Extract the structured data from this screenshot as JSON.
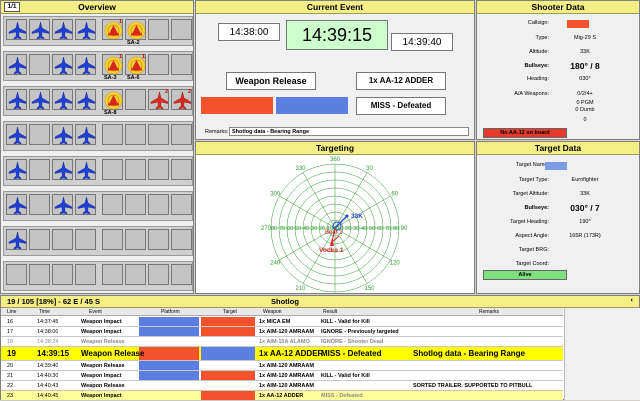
{
  "overview": {
    "title": "Overview",
    "page": "1/1",
    "rows": [
      {
        "cells": [
          "blue-jet",
          "blue-jet",
          "blue-jet",
          "blue-jet",
          "sam-site",
          "sam-site",
          "empty",
          "empty"
        ],
        "nums": [
          "",
          "",
          "",
          "",
          "1",
          "",
          "",
          ""
        ],
        "labels": [
          "",
          "",
          "",
          "",
          "",
          "SA-2",
          "",
          ""
        ]
      },
      {
        "cells": [
          "blue-jet",
          "empty",
          "blue-jet",
          "blue-jet",
          "sam-site",
          "sam-site",
          "empty",
          "empty"
        ],
        "nums": [
          "",
          "",
          "",
          "",
          "1",
          "1",
          "",
          ""
        ],
        "labels": [
          "",
          "",
          "",
          "",
          "SA-3",
          "SA-6",
          "",
          ""
        ]
      },
      {
        "cells": [
          "blue-jet",
          "blue-jet",
          "blue-jet",
          "blue-jet",
          "sam-site",
          "empty",
          "red-jet",
          "red-jet"
        ],
        "nums": [
          "",
          "",
          "",
          "",
          "",
          "",
          "2",
          "2"
        ],
        "labels": [
          "",
          "",
          "",
          "",
          "SA-8",
          "",
          "",
          ""
        ]
      },
      {
        "cells": [
          "blue-jet",
          "empty",
          "blue-jet",
          "blue-jet",
          "empty",
          "empty",
          "empty",
          "empty"
        ],
        "nums": [
          "",
          "",
          "",
          "",
          "",
          "",
          "",
          ""
        ],
        "labels": [
          "",
          "",
          "",
          "",
          "",
          "",
          "",
          ""
        ]
      },
      {
        "cells": [
          "blue-jet",
          "empty",
          "blue-jet",
          "blue-jet",
          "empty",
          "empty",
          "empty",
          "empty"
        ],
        "nums": [
          "",
          "",
          "",
          "",
          "",
          "",
          "",
          ""
        ],
        "labels": [
          "",
          "",
          "",
          "",
          "",
          "",
          "",
          ""
        ]
      },
      {
        "cells": [
          "blue-jet",
          "empty",
          "blue-jet",
          "blue-jet",
          "empty",
          "empty",
          "empty",
          "empty"
        ],
        "nums": [
          "",
          "",
          "",
          "",
          "",
          "",
          "",
          ""
        ],
        "labels": [
          "",
          "",
          "",
          "",
          "",
          "",
          "",
          ""
        ]
      },
      {
        "cells": [
          "blue-jet",
          "empty",
          "empty",
          "empty",
          "empty",
          "empty",
          "empty",
          "empty"
        ],
        "nums": [
          "",
          "",
          "",
          "",
          "",
          "",
          "",
          ""
        ],
        "labels": [
          "",
          "",
          "",
          "",
          "",
          "",
          "",
          ""
        ]
      },
      {
        "cells": [
          "empty",
          "empty",
          "empty",
          "empty",
          "empty",
          "empty",
          "empty",
          "empty"
        ],
        "nums": [
          "",
          "",
          "",
          "",
          "",
          "",
          "",
          ""
        ],
        "labels": [
          "",
          "",
          "",
          "",
          "",
          "",
          "",
          ""
        ]
      }
    ]
  },
  "current_event": {
    "title": "Current Event",
    "time_prev": "14:38:00",
    "time_now": "14:39:15",
    "time_next": "14:39:40",
    "event_type": "Weapon Release",
    "weapon": "1x AA-12 ADDER",
    "result": "MISS - Defeated",
    "shooter_color": "#f4522c",
    "target_color": "#5b7fe0",
    "remarks_label": "Remarks:",
    "remarks": "Shotlog data - Bearing Range"
  },
  "targeting": {
    "title": "Targeting",
    "ring_labels": [
      "10",
      "20",
      "30",
      "40",
      "50",
      "60",
      "70",
      "80"
    ],
    "bearing_labels": [
      "360",
      "30",
      "60",
      "90",
      "120",
      "150",
      "180",
      "210",
      "240",
      "270",
      "300",
      "330"
    ],
    "contacts": [
      {
        "label": "33K",
        "color": "#2244cc"
      },
      {
        "label": "Vodka 1",
        "color": "#cc2222"
      },
      {
        "label": "Bear 2",
        "color": "#cc2222"
      }
    ]
  },
  "shooter": {
    "title": "Shooter Data",
    "callsign_label": "Callsign:",
    "callsign_color": "#f4522c",
    "type_label": "Type:",
    "type": "Mig-29 S",
    "altitude_label": "Altitude:",
    "altitude": "33K",
    "bullseye_label": "Bullseye:",
    "bullseye": "180° / 8",
    "heading_label": "Heading:",
    "heading": "030°",
    "aa_label": "A/A Weapons:",
    "aa": "0/2/4+",
    "pgm": "0 PGM",
    "dumb": "0 Dumb",
    "zero": "0",
    "status": "No AA-12 on board",
    "status_color": "#e63a2a"
  },
  "target": {
    "title": "Target Data",
    "name_label": "Target Name:",
    "name_color": "#7a9be6",
    "type_label": "Target Type:",
    "type": "Eurofighter",
    "altitude_label": "Target Altitude:",
    "altitude": "33K",
    "bullseye_label": "Bullseye:",
    "bullseye": "030° / 7",
    "heading_label": "Target Heading:",
    "heading": "190°",
    "aspect_label": "Aspect Angle:",
    "aspect": "165R (173R)",
    "brg_label": "Target BRG:",
    "coord_label": "Target Coord:",
    "status": "Alive",
    "status_color": "#7fe07f"
  },
  "shotlog": {
    "title": "Shotlog",
    "summary": "19 / 105 [18%] - 62 E / 45 S",
    "columns": [
      "Line",
      "Time",
      "Event",
      "Platform",
      "Target",
      "Weapon",
      "Result",
      "Remarks"
    ],
    "rows": [
      {
        "line": "16",
        "time": "14:37:45",
        "event": "Weapon Impact",
        "platform": "#5b7fe0",
        "target": "#f4522c",
        "weapon": "1x MICA EM",
        "result": "KILL - Valid for Kill",
        "remarks": "",
        "style": ""
      },
      {
        "line": "17",
        "time": "14:38:00",
        "event": "Weapon Impact",
        "platform": "#5b7fe0",
        "target": "#f4522c",
        "weapon": "1x AIM-120 AMRAAM",
        "result": "IGNORE - Previously targeted",
        "remarks": "",
        "style": ""
      },
      {
        "line": "18",
        "time": "14:38:24",
        "event": "Weapon Release",
        "platform": "",
        "target": "",
        "weapon": "1x AIM-10A ALAMO",
        "result": "IGNORE - Shooter Dead",
        "remarks": "",
        "style": "gray"
      },
      {
        "line": "19",
        "time": "14:39:15",
        "event": "Weapon Release",
        "platform": "#f4522c",
        "target": "#5b7fe0",
        "weapon": "1x AA-12 ADDER",
        "result": "MISS - Defeated",
        "remarks": "Shotlog data - Bearing Range",
        "style": "sel"
      },
      {
        "line": "20",
        "time": "14:39:40",
        "event": "Weapon Release",
        "platform": "#5b7fe0",
        "target": "",
        "weapon": "1x AIM-120 AMRAAM",
        "result": "",
        "remarks": "",
        "style": ""
      },
      {
        "line": "21",
        "time": "14:40:30",
        "event": "Weapon Impact",
        "platform": "#5b7fe0",
        "target": "#f4522c",
        "weapon": "1x AIM-120 AMRAAM",
        "result": "KILL - Valid for Kill",
        "remarks": "",
        "style": ""
      },
      {
        "line": "22",
        "time": "14:40:43",
        "event": "Weapon Release",
        "platform": "",
        "target": "",
        "weapon": "1x AIM-120 AMRAAM",
        "result": "",
        "remarks": "SORTED TRAILER. SUPPORTED TO PITBULL",
        "style": ""
      },
      {
        "line": "23",
        "time": "14:40:45",
        "event": "Weapon Impact",
        "platform": "",
        "target": "",
        "weapon": "1x AA-12 ADDER",
        "result": "MISS - Defeated",
        "remarks": "",
        "style": "gray-hl"
      }
    ]
  }
}
